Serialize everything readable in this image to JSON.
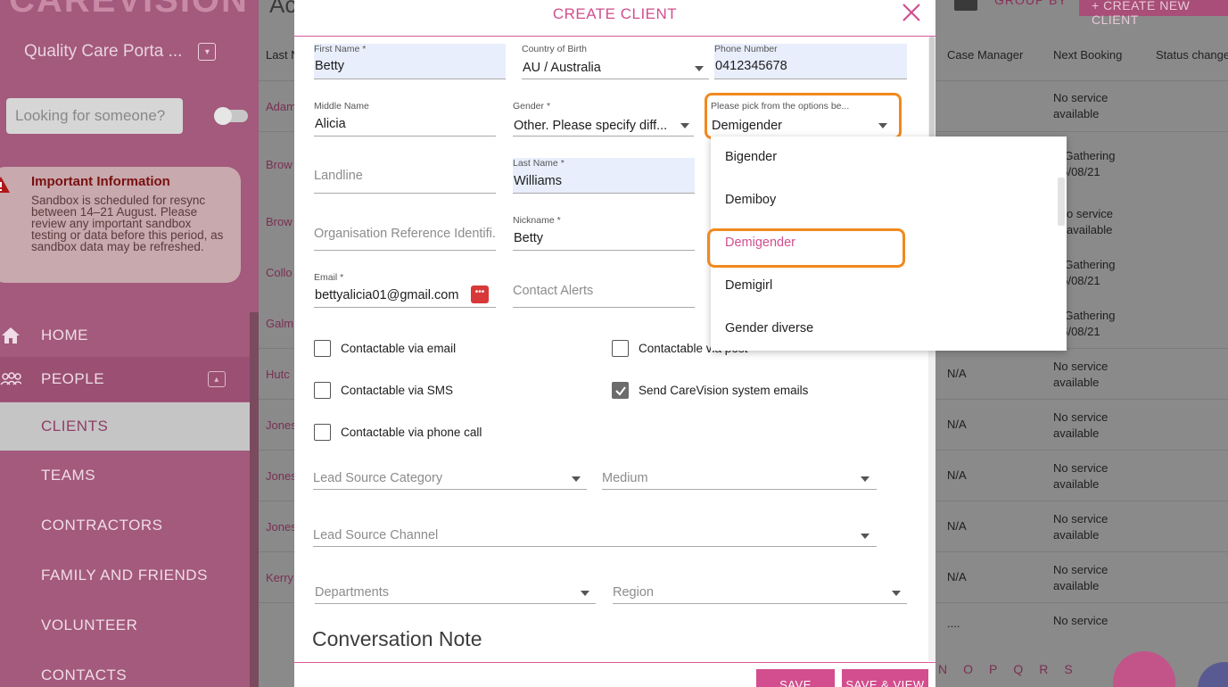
{
  "sidebar": {
    "logo": "CAREVISION",
    "portal": "Quality Care Porta ...",
    "search_placeholder": "Looking for someone?",
    "info": {
      "title": "Important Information",
      "body": "Sandbox is scheduled for resync between 14–21 August. Please review any important sandbox testing or data before this period, as sandbox data may be refreshed."
    },
    "nav": {
      "home": "HOME",
      "people": "PEOPLE",
      "clients": "CLIENTS",
      "teams": "TEAMS",
      "contractors": "CONTRACTORS",
      "family": "FAMILY AND FRIENDS",
      "volunteer": "VOLUNTEER",
      "contacts": "CONTACTS"
    }
  },
  "main": {
    "title": "Ac",
    "group_by": "GROUP BY",
    "create_new": "+ CREATE NEW CLIENT",
    "columns": {
      "last_name": "Last N",
      "case_manager": "Case Manager",
      "next_booking": "Next Booking",
      "status_changed": "Status changed"
    },
    "rows": [
      {
        "name": "Adam",
        "case": "",
        "booking": "No service available"
      },
      {
        "name": "Brow",
        "case": "",
        "booking": "L Gathering 26/08/21"
      },
      {
        "name": "Brow",
        "case": "",
        "booking": "o service available"
      },
      {
        "name": "Collo",
        "case": "",
        "booking": "L Gathering 26/08/21"
      },
      {
        "name": "Galm",
        "case": "",
        "booking": "L Gathering 26/08/21"
      },
      {
        "name": "Hutc",
        "case": "N/A",
        "booking": "No service available"
      },
      {
        "name": "Jones",
        "case": "N/A",
        "booking": "No service available"
      },
      {
        "name": "Jones",
        "case": "N/A",
        "booking": "No service available"
      },
      {
        "name": "Jones",
        "case": "N/A",
        "booking": "No service available"
      },
      {
        "name": "Kerry",
        "case": "N/A",
        "booking": "No service available"
      },
      {
        "name": "",
        "case": "....",
        "booking": "No service"
      }
    ],
    "letters": [
      "N",
      "O",
      "P",
      "Q",
      "R",
      "S"
    ]
  },
  "modal": {
    "title": "CREATE CLIENT",
    "first_name": {
      "label": "First Name *",
      "value": "Betty"
    },
    "country": {
      "label": "Country of Birth",
      "value": "AU / Australia"
    },
    "phone": {
      "label": "Phone Number",
      "value": "0412345678"
    },
    "middle_name": {
      "label": "Middle Name",
      "value": "Alicia"
    },
    "gender": {
      "label": "Gender *",
      "value": "Other. Please specify diff..."
    },
    "gender_other": {
      "label": "Please pick from the options be...",
      "value": "Demigender"
    },
    "landline": {
      "placeholder": "Landline"
    },
    "last_name": {
      "label": "Last Name *",
      "value": "Williams"
    },
    "org_ref": {
      "placeholder": "Organisation Reference Identifi..."
    },
    "nickname": {
      "label": "Nickname *",
      "value": "Betty"
    },
    "email": {
      "label": "Email *",
      "value": "bettyalicia01@gmail.com"
    },
    "contact_alerts": {
      "placeholder": "Contact Alerts"
    },
    "checks": {
      "email": "Contactable via email",
      "post": "Contactable via post",
      "sms": "Contactable via SMS",
      "system_emails": "Send CareVision system emails",
      "phone": "Contactable via phone call"
    },
    "lead_source_category": "Lead Source Category",
    "medium": "Medium",
    "lead_source_channel": "Lead Source Channel",
    "departments": "Departments",
    "region": "Region",
    "conversation_note": "Conversation Note",
    "save": "SAVE",
    "save_view": "SAVE & VIEW"
  },
  "dropdown": {
    "options": [
      "Bigender",
      "Demiboy",
      "Demigender",
      "Demigirl",
      "Gender diverse"
    ],
    "selected": "Demigender"
  },
  "colors": {
    "accent": "#d24e8e",
    "highlight": "#f08a1e"
  }
}
